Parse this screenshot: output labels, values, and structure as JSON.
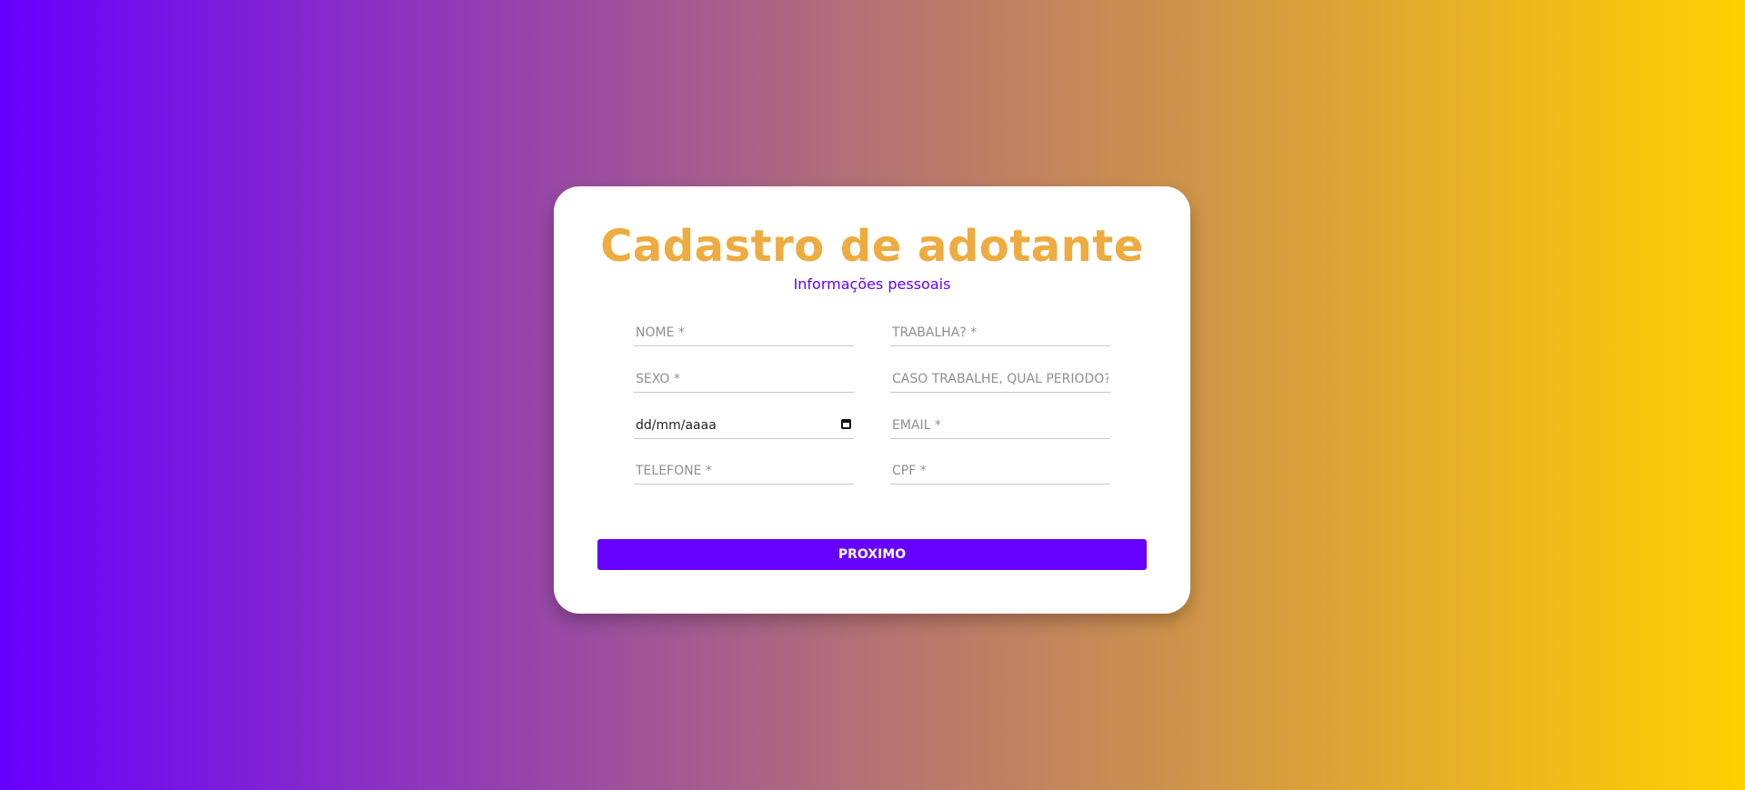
{
  "page": {
    "title": "Cadastro de adotante",
    "subtitle": "Informações pessoais",
    "colors": {
      "title": "#eeab3f",
      "accent": "#6600ff",
      "gradient_start": "#6600ff",
      "gradient_end": "#ffd000"
    }
  },
  "form": {
    "nome": {
      "placeholder": "NOME *",
      "value": ""
    },
    "trabalha": {
      "placeholder": "TRABALHA? *",
      "value": ""
    },
    "sexo": {
      "placeholder": "SEXO *",
      "value": ""
    },
    "periodo": {
      "placeholder": "CASO TRABALHE, QUAL PERIODO?",
      "value": ""
    },
    "data": {
      "display": "dd/mm/aaaa",
      "icon": "calendar-icon"
    },
    "email": {
      "placeholder": "EMAIL *",
      "value": ""
    },
    "telefone": {
      "placeholder": "TELEFONE *",
      "value": ""
    },
    "cpf": {
      "placeholder": "CPF *",
      "value": ""
    }
  },
  "actions": {
    "next_label": "PROXIMO"
  }
}
